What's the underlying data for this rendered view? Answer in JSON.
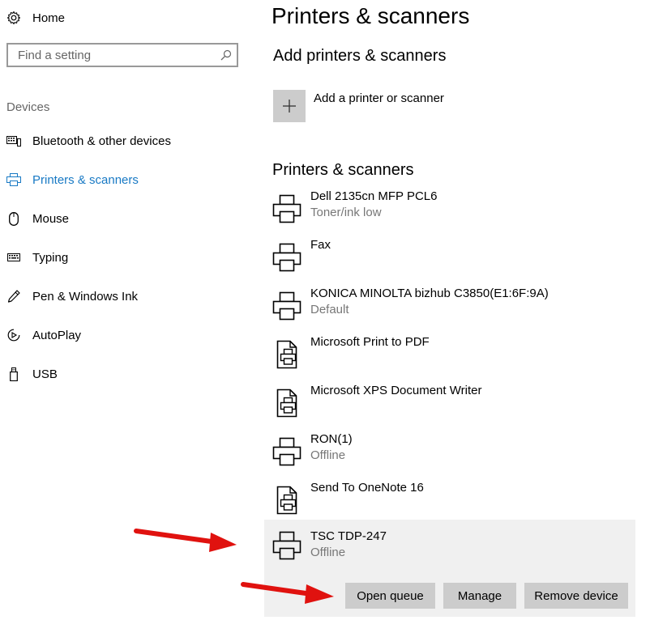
{
  "sidebar": {
    "home_label": "Home",
    "search_placeholder": "Find a setting",
    "section_label": "Devices",
    "items": [
      {
        "label": "Bluetooth & other devices",
        "icon": "keyboard-device-icon"
      },
      {
        "label": "Printers & scanners",
        "icon": "printer-icon",
        "active": true
      },
      {
        "label": "Mouse",
        "icon": "mouse-icon"
      },
      {
        "label": "Typing",
        "icon": "keyboard-icon"
      },
      {
        "label": "Pen & Windows Ink",
        "icon": "pen-icon"
      },
      {
        "label": "AutoPlay",
        "icon": "autoplay-icon"
      },
      {
        "label": "USB",
        "icon": "usb-icon"
      }
    ]
  },
  "main": {
    "title": "Printers & scanners",
    "add_heading": "Add printers & scanners",
    "add_label": "Add a printer or scanner",
    "list_heading": "Printers & scanners",
    "printers": [
      {
        "name": "Dell 2135cn MFP PCL6",
        "status": "Toner/ink low",
        "icon": "printer-icon"
      },
      {
        "name": "Fax",
        "status": "",
        "icon": "printer-icon"
      },
      {
        "name": "KONICA MINOLTA bizhub C3850(E1:6F:9A)",
        "status": "Default",
        "icon": "printer-icon"
      },
      {
        "name": "Microsoft Print to PDF",
        "status": "",
        "icon": "document-printer-icon"
      },
      {
        "name": "Microsoft XPS Document Writer",
        "status": "",
        "icon": "document-printer-icon"
      },
      {
        "name": "RON(1)",
        "status": "Offline",
        "icon": "printer-icon"
      },
      {
        "name": "Send To OneNote 16",
        "status": "",
        "icon": "document-printer-icon"
      },
      {
        "name": "TSC TDP-247",
        "status": "Offline",
        "icon": "printer-icon",
        "selected": true
      }
    ],
    "actions": {
      "open_queue": "Open queue",
      "manage": "Manage",
      "remove_device": "Remove device"
    }
  },
  "colors": {
    "accent": "#1879c4",
    "arrow": "#e0120f",
    "selected_bg": "#f0f0f0",
    "button_bg": "#cccccc"
  }
}
